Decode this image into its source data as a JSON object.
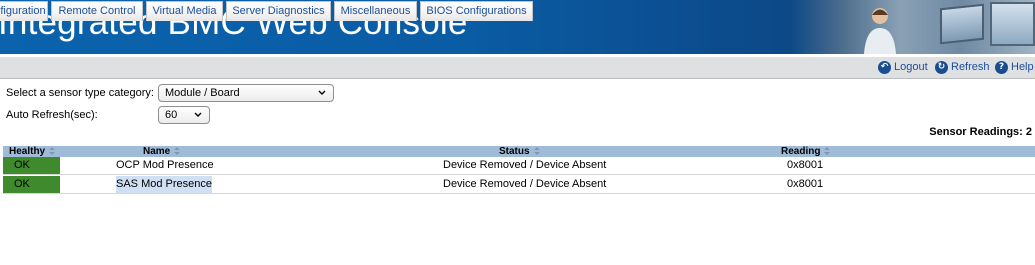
{
  "banner": {
    "title": "Integrated BMC Web Console"
  },
  "tabs": [
    {
      "label": "figuration"
    },
    {
      "label": "Remote Control"
    },
    {
      "label": "Virtual Media"
    },
    {
      "label": "Server Diagnostics"
    },
    {
      "label": "Miscellaneous"
    },
    {
      "label": "BIOS Configurations"
    }
  ],
  "toolbar": {
    "logout_label": "Logout",
    "refresh_label": "Refresh",
    "help_label": "Help"
  },
  "form": {
    "sensor_type_label": "Select a sensor type category:",
    "sensor_type_value": "Module / Board",
    "auto_refresh_label": "Auto Refresh(sec):",
    "auto_refresh_value": "60"
  },
  "sensor_readings": {
    "label": "Sensor Readings: 2"
  },
  "table": {
    "headers": {
      "healthy": "Healthy",
      "name": "Name",
      "status": "Status",
      "reading": "Reading"
    },
    "rows": [
      {
        "healthy": "OK",
        "name": "OCP Mod Presence",
        "status": "Device Removed / Device Absent",
        "reading": "0x8001"
      },
      {
        "healthy": "OK",
        "name": "SAS Mod Presence",
        "status": "Device Removed / Device Absent",
        "reading": "0x8001"
      }
    ]
  },
  "colors": {
    "banner_blue": "#0b63ad",
    "header_row": "#a0bbd8",
    "ok_green": "#3f8a2c",
    "link_blue": "#1c4d9a"
  }
}
